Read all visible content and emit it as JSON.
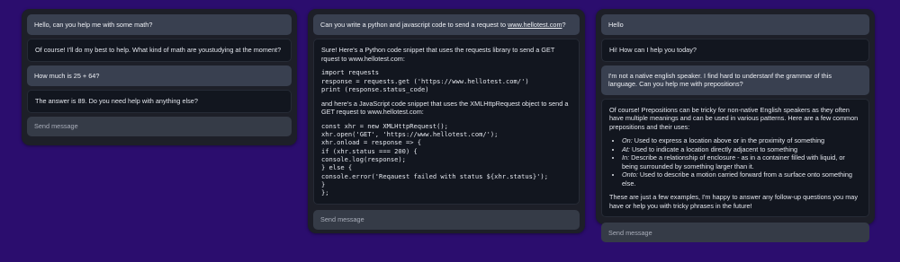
{
  "panel1": {
    "messages": [
      {
        "role": "user",
        "text": "Hello, can you help me with some math?"
      },
      {
        "role": "assistant",
        "text": "Of course! I'll do my best to help. What kind of math are youstudying at the moment?"
      },
      {
        "role": "user",
        "text": "How much is 25 + 64?"
      },
      {
        "role": "assistant",
        "text": "The answer is 89. Do you need help with anything else?"
      }
    ],
    "input_placeholder": "Send message"
  },
  "panel2": {
    "user_text_prefix": "Can you write a python and javascript code to send a request to ",
    "user_link": "www.hellotest.com",
    "user_text_suffix": "?",
    "assistant": {
      "intro": "Sure! Here's a Python code snippet that uses the requests library to send a GET rquest to www.hellotest.com:",
      "python_code": "import requests\nresponse = requests.get ('https://www.hellotest.com/')\nprint (response.status_code)",
      "js_intro": "and here's a JavaScript code snippet that uses the XMLHttpRequest object to send a GET request to www.hellotest.com:",
      "js_code": "const xhr = new XMLHttpRequest();\nxhr.open('GET', 'https://www.hellotest.com/');\nxhr.onload = response => {\nif (xhr.status === 200) {\nconsole.log(response);\n} else {\nconsole.error('Reqauest failed with status ${xhr.status}');\n}\n};"
    },
    "input_placeholder": "Send message"
  },
  "panel3": {
    "msg1": "Hello",
    "msg2": "Hi! How can I help you today?",
    "msg3": "I'm not a native english speaker. I find hard to understanf the grammar of this language. Can you help me with prepositions?",
    "assistant": {
      "intro": "Of course! Prepositions can be tricky for non-native English speakers as they often have multiple meanings and can be used in various patterns. Here are a few common prepositions and their uses:",
      "items": [
        {
          "term": "On:",
          "desc": " Used to express a location above or in the proximity of something"
        },
        {
          "term": "At:",
          "desc": " Used to indicate a location directly adjacent to something"
        },
        {
          "term": "In:",
          "desc": " Describe a relationship of enclosure - as in a container filled with liquid, or being surrounded by something larger than it."
        },
        {
          "term": "Onto:",
          "desc": " Used to describe a motion carried forward from a surface onto something else."
        }
      ],
      "outro": "These are just a few examples, I'm happy to answer any follow-up questions you may have or help you with tricky phrases in the future!"
    },
    "input_placeholder": "Send message"
  }
}
